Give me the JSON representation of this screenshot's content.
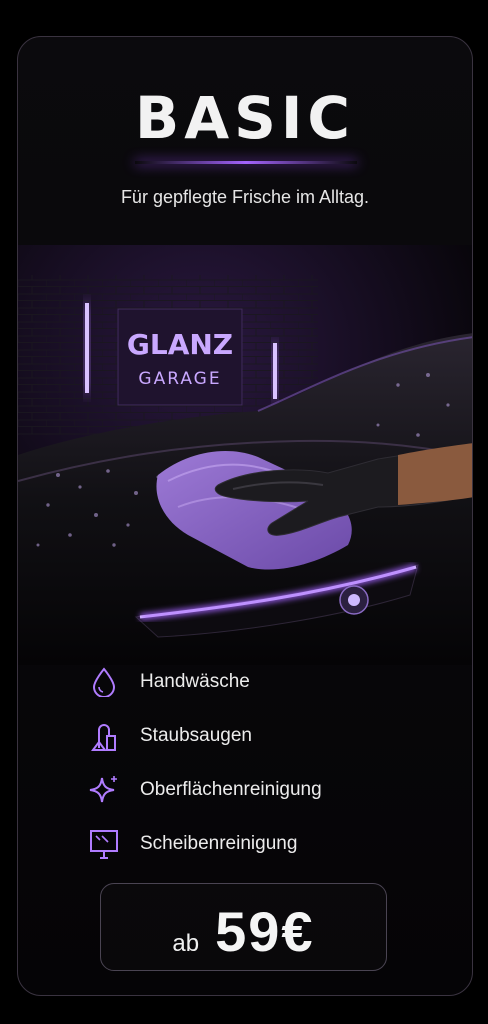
{
  "card": {
    "title": "BASIC",
    "subtitle": "Für gepflegte Frische im Alltag."
  },
  "sign": {
    "line1": "GLANZ",
    "line2": "GARAGE"
  },
  "features": [
    {
      "icon": "water-drop-icon",
      "label": "Handwäsche"
    },
    {
      "icon": "vacuum-icon",
      "label": "Staubsaugen"
    },
    {
      "icon": "sparkle-icon",
      "label": "Oberflächenreinigung"
    },
    {
      "icon": "window-icon",
      "label": "Scheibenreinigung"
    }
  ],
  "price": {
    "prefix": "ab",
    "amount": "59€"
  },
  "colors": {
    "accent": "#a463ff",
    "neon": "#b07cff",
    "background": "#08070a",
    "text": "#ececec"
  }
}
